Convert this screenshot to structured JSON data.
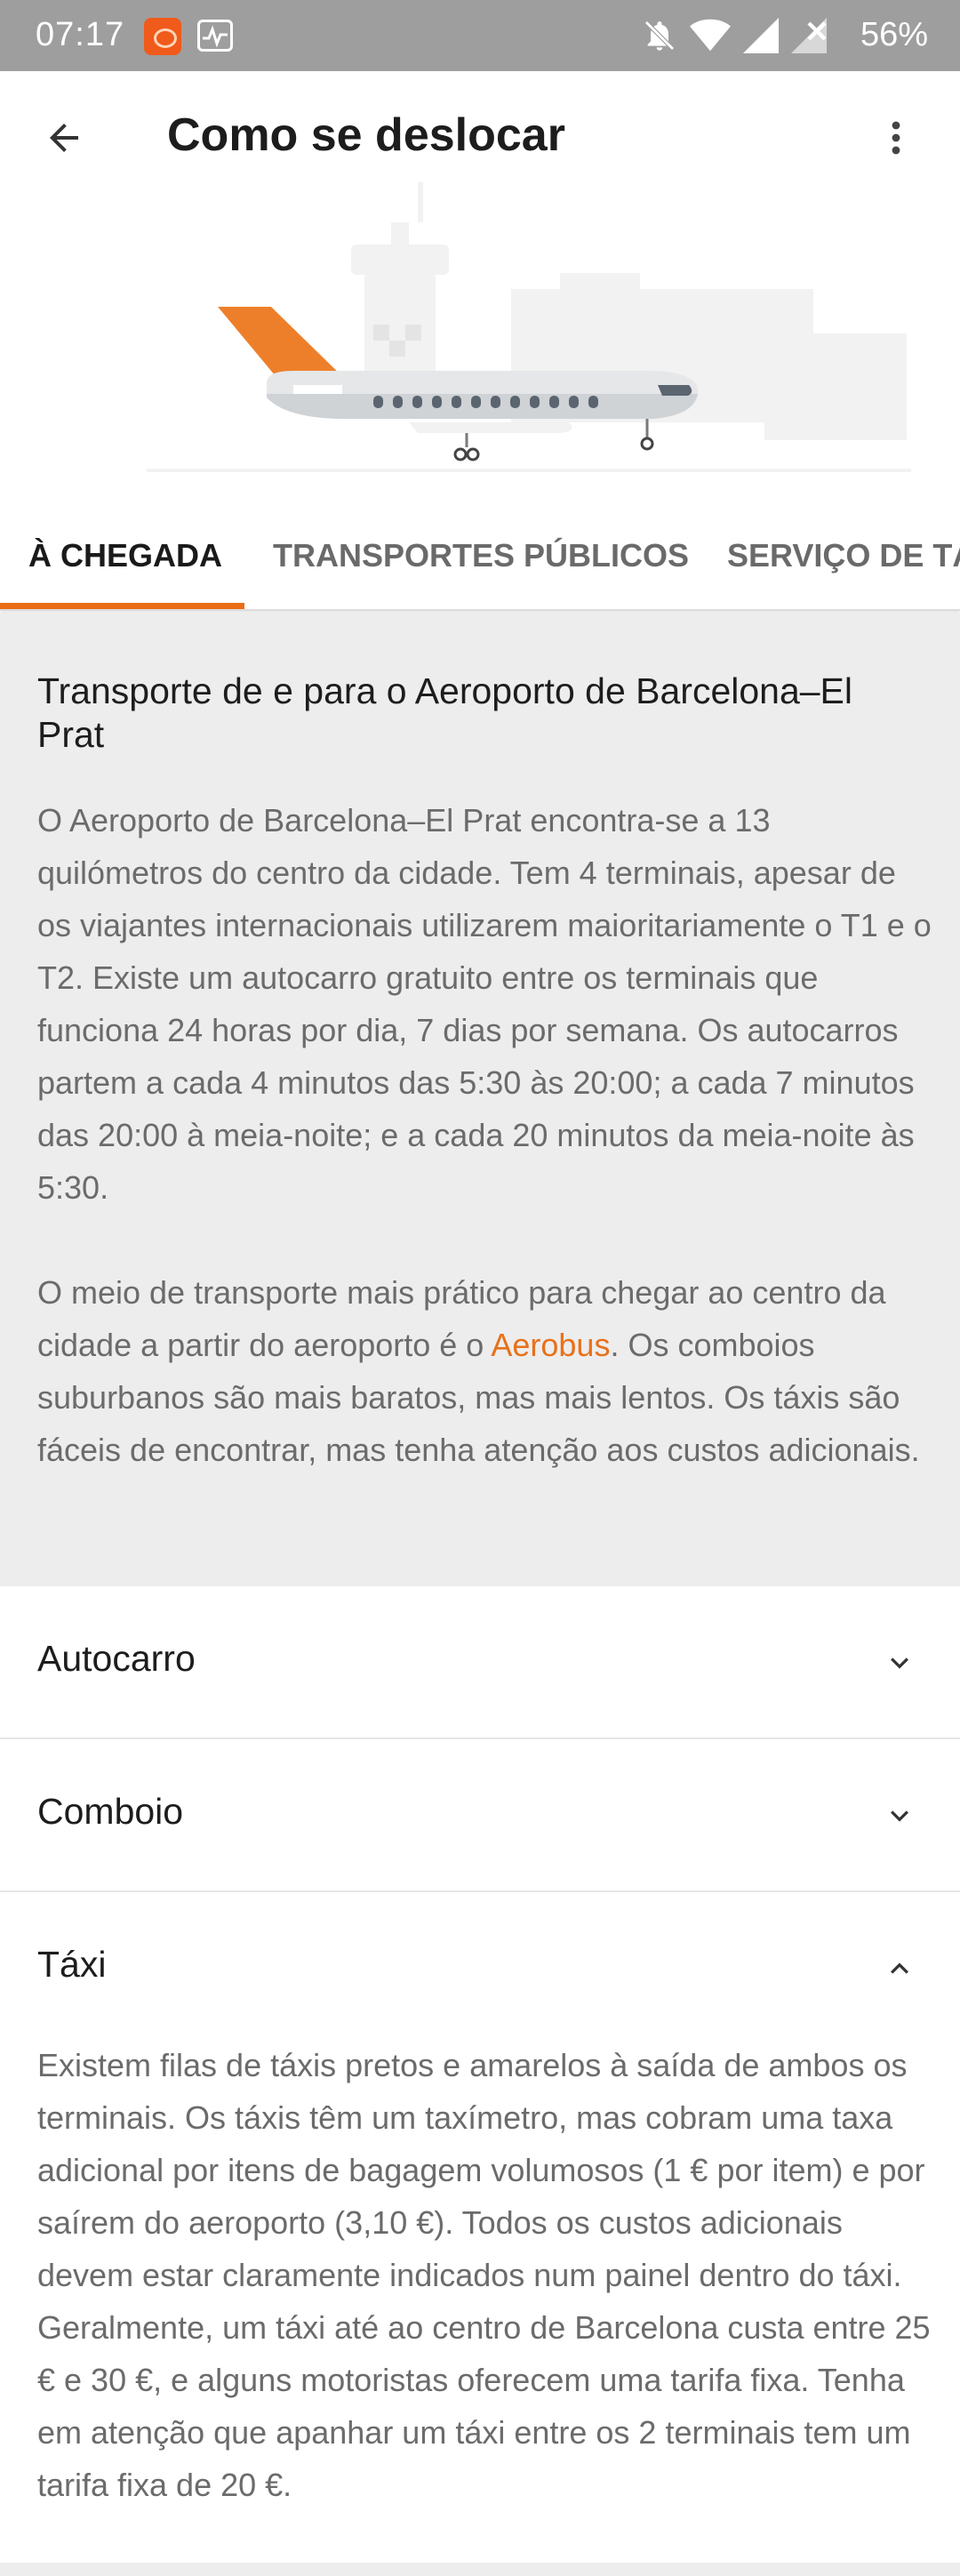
{
  "status_bar": {
    "time": "07:17",
    "battery": "56%",
    "icons": [
      "notification-app-icon",
      "activity-icon",
      "bell-off-icon",
      "wifi-icon",
      "signal-icon",
      "no-sim-icon"
    ]
  },
  "app_bar": {
    "title": "Como se deslocar",
    "back_icon": "arrow-left-icon",
    "menu_icon": "more-vertical-icon"
  },
  "tabs": [
    {
      "label": "À CHEGADA",
      "active": true
    },
    {
      "label": "TRANSPORTES PÚBLICOS",
      "active": false
    },
    {
      "label": "SERVIÇO DE TÁXI",
      "active": false
    }
  ],
  "intro": {
    "title": "Transporte de e para o Aeroporto de Barcelona–El Prat",
    "paragraph1": "O Aeroporto de Barcelona–El Prat encontra-se a 13 quilómetros do centro da cidade. Tem 4 terminais, apesar de os viajantes internacionais utilizarem maioritariamente o T1 e o T2. Existe um autocarro gratuito entre os terminais que funciona 24 horas por dia, 7 dias por semana. Os autocarros partem a cada 4 minutos das 5:30 às 20:00; a cada 7 minutos das 20:00 à meia-noite; e a cada 20 minutos da meia-noite às 5:30.",
    "paragraph2_before": "O meio de transporte mais prático para chegar ao centro da cidade a partir do aeroporto é o ",
    "paragraph2_link": "Aerobus",
    "paragraph2_after": ". Os comboios suburbanos são mais baratos, mas mais lentos. Os táxis são fáceis de encontrar, mas tenha atenção aos custos adicionais."
  },
  "sections": [
    {
      "label": "Autocarro",
      "expanded": false
    },
    {
      "label": "Comboio",
      "expanded": false
    },
    {
      "label": "Táxi",
      "expanded": true
    }
  ],
  "taxi_text": "Existem filas de táxis pretos e amarelos à saída de ambos os terminais. Os táxis têm um taxímetro, mas cobram uma taxa adicional por itens de bagagem volumosos (1 € por item) e por saírem do aeroporto (3,10 €). Todos os custos adicionais devem estar claramente indicados num painel dentro do táxi. Geralmente, um táxi até ao centro de Barcelona custa entre 25 € e 30 €, e alguns motoristas oferecem uma tarifa fixa. Tenha em atenção que apanhar um táxi entre os 2 terminais tem um tarifa fixa de 20 €.",
  "colors": {
    "accent": "#e96d14",
    "status_bar": "#9e9e9e",
    "section_bg": "#ededed",
    "body_text": "#6b6b6b"
  }
}
